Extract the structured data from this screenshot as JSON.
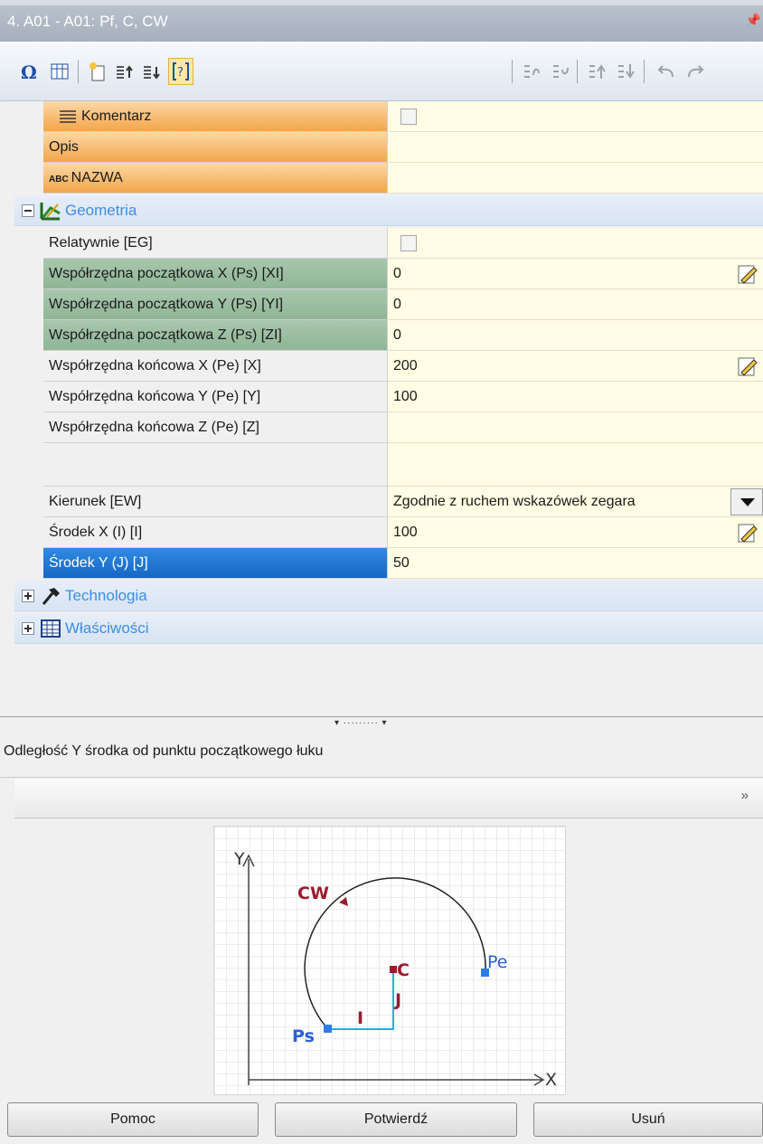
{
  "window": {
    "title": "4. A01 - A01: Pf, C, CW",
    "pin_icon": "pin-icon"
  },
  "toolbar": {
    "icons": [
      "omega-icon",
      "grid-icon",
      "new-icon",
      "move-up-icon",
      "move-down-icon",
      "brackets-icon",
      "open-icon",
      "save-icon",
      "up-icon",
      "down-icon",
      "undo-icon",
      "redo-icon"
    ]
  },
  "properties": {
    "komentarz": "Komentarz",
    "opis": "Opis",
    "nazwa_prefix": "ABC",
    "nazwa": "NAZWA",
    "group_geometria": "Geometria",
    "relatywnie": "Relatywnie [EG]",
    "xi_label": "Współrzędna początkowa X (Ps) [XI]",
    "xi_value": "0",
    "yi_label": "Współrzędna początkowa Y (Ps) [YI]",
    "yi_value": "0",
    "zi_label": "Współrzędna początkowa Z (Ps) [ZI]",
    "zi_value": "0",
    "x_label": "Współrzędna końcowa X (Pe) [X]",
    "x_value": "200",
    "y_label": "Współrzędna końcowa Y (Pe) [Y]",
    "y_value": "100",
    "z_label": "Współrzędna końcowa Z (Pe) [Z]",
    "z_value": "",
    "kierunek_label": "Kierunek [EW]",
    "kierunek_value": "Zgodnie z ruchem wskazówek zegara",
    "sx_label": "Środek X (I) [I]",
    "sx_value": "100",
    "sy_label": "Środek Y (J) [J]",
    "sy_value": "50",
    "group_technologia": "Technologia",
    "group_wlasciwosci": "Właściwości"
  },
  "help": {
    "text": "Odległość Y środka od punktu początkowego łuku",
    "expand_icon": "double-chevron-down-icon"
  },
  "diagram": {
    "y_axis": "Y",
    "x_axis": "X",
    "cw": "CW",
    "pe": "Pe",
    "ps": "Ps",
    "c": "C",
    "i": "I",
    "j": "J",
    "colors": {
      "arc": "#222222",
      "points": "#2b7de9",
      "labels": "#9b1c2e",
      "guides": "#1fb0e0",
      "point_labels": "#2b5fd9"
    }
  },
  "buttons": {
    "help": "Pomoc",
    "confirm": "Potwierdź",
    "delete": "Usuń"
  }
}
